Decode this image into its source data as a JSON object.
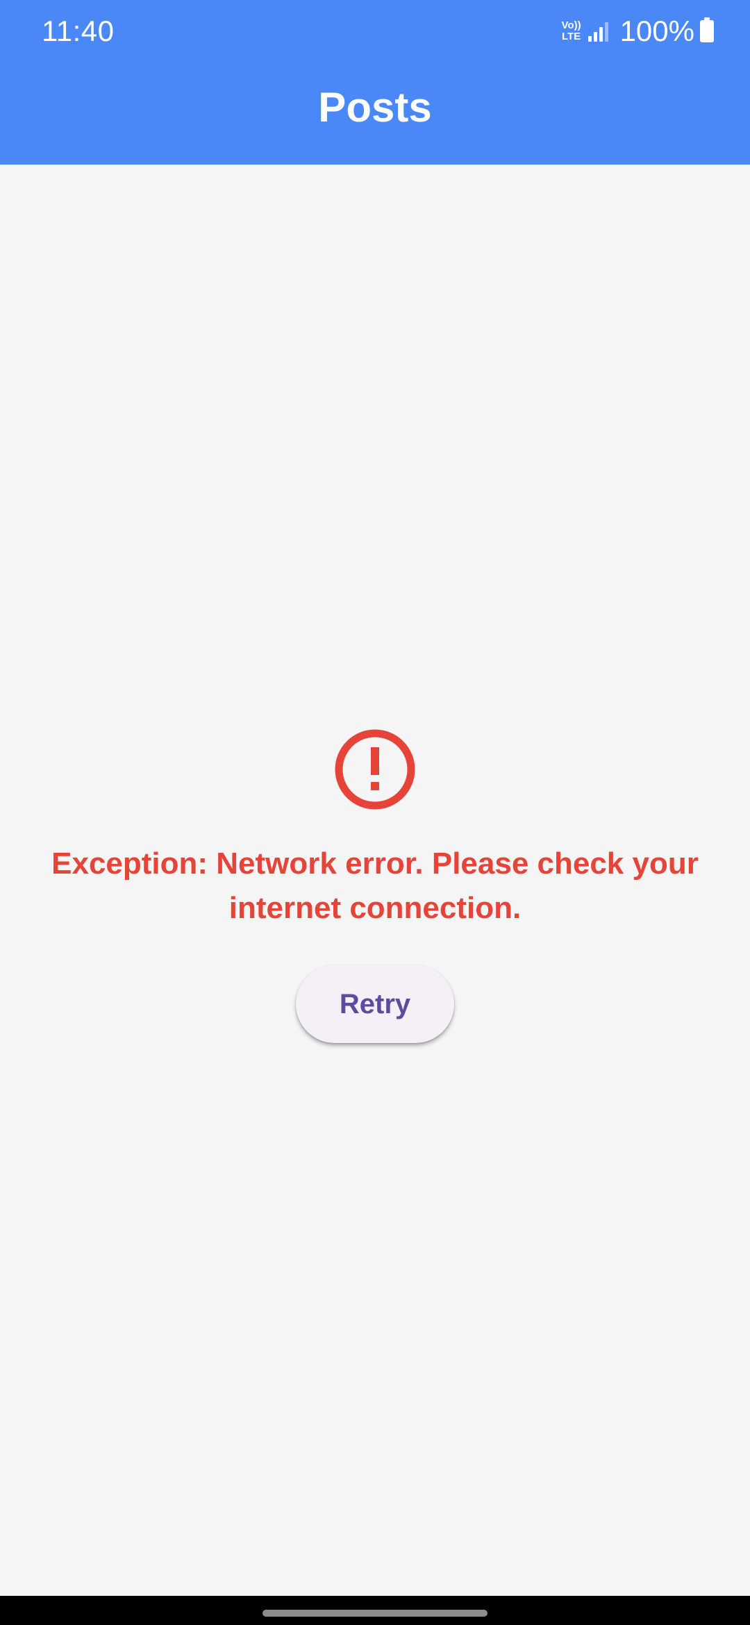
{
  "status_bar": {
    "time": "11:40",
    "network_top": "Vo))",
    "network_bottom": "LTE",
    "battery_percent": "100%",
    "icons": [
      "volte-icon",
      "signal-icon",
      "battery-icon"
    ]
  },
  "app_bar": {
    "title": "Posts"
  },
  "error": {
    "icon": "error-icon",
    "message": "Exception: Network error. Please check your internet connection.",
    "retry_label": "Retry"
  },
  "colors": {
    "app_bar": "#4a88f7",
    "background": "#f5f5f5",
    "error": "#e64339",
    "button_text": "#5e4b9e",
    "button_background": "#f5f0f8"
  }
}
